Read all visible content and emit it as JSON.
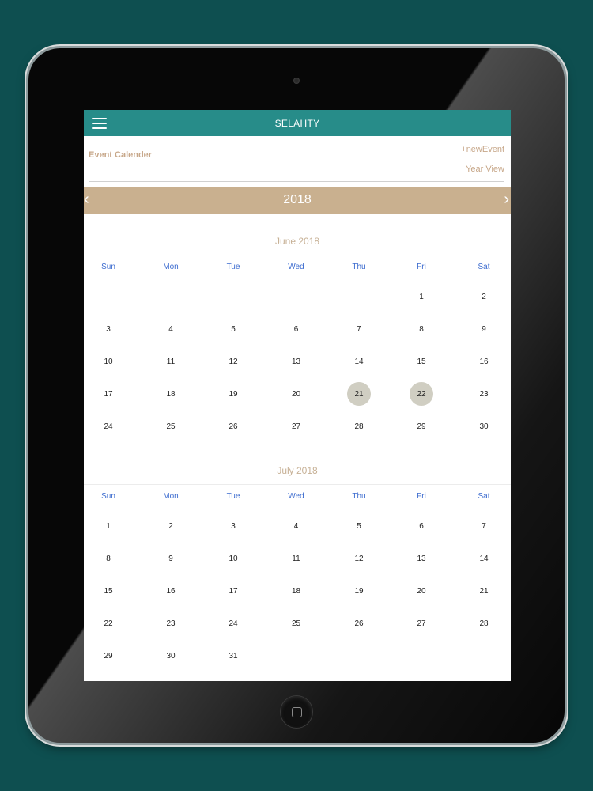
{
  "app": {
    "title": "SELAHTY"
  },
  "subheader": {
    "section_title": "Event Calender",
    "new_event_label": "+newEvent",
    "year_view_label": "Year View"
  },
  "year_nav": {
    "year": "2018",
    "prev_label": "‹",
    "next_label": "›"
  },
  "weekdays": [
    "Sun",
    "Mon",
    "Tue",
    "Wed",
    "Thu",
    "Fri",
    "Sat"
  ],
  "months": [
    {
      "title": "June 2018",
      "weeks": [
        [
          "",
          "",
          "",
          "",
          "",
          "1",
          "2"
        ],
        [
          "3",
          "4",
          "5",
          "6",
          "7",
          "8",
          "9"
        ],
        [
          "10",
          "11",
          "12",
          "13",
          "14",
          "15",
          "16"
        ],
        [
          "17",
          "18",
          "19",
          "20",
          "21",
          "22",
          "23"
        ],
        [
          "24",
          "25",
          "26",
          "27",
          "28",
          "29",
          "30"
        ]
      ],
      "highlighted": [
        "21",
        "22"
      ]
    },
    {
      "title": "July 2018",
      "weeks": [
        [
          "1",
          "2",
          "3",
          "4",
          "5",
          "6",
          "7"
        ],
        [
          "8",
          "9",
          "10",
          "11",
          "12",
          "13",
          "14"
        ],
        [
          "15",
          "16",
          "17",
          "18",
          "19",
          "20",
          "21"
        ],
        [
          "22",
          "23",
          "24",
          "25",
          "26",
          "27",
          "28"
        ],
        [
          "29",
          "30",
          "31",
          "",
          "",
          "",
          ""
        ]
      ],
      "highlighted": []
    }
  ],
  "colors": {
    "background": "#0e4f50",
    "topbar": "#278c89",
    "accent_tan": "#c9b08f",
    "weekday_blue": "#3d6ccf",
    "highlight_day": "#d0cec2"
  },
  "icons": {
    "menu": "hamburger-menu-icon",
    "prev": "chevron-left-icon",
    "next": "chevron-right-icon",
    "home": "home-button-icon"
  }
}
